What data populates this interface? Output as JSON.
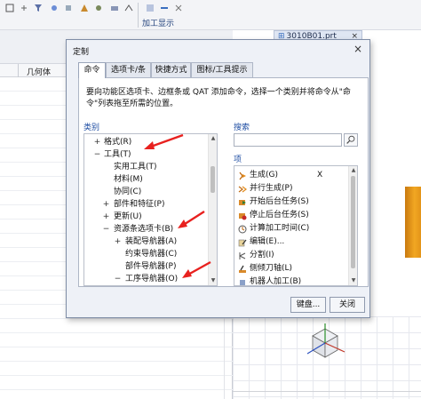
{
  "ribbon": {
    "group_label": "加工显示"
  },
  "left_panel": {
    "column_header": "几何体"
  },
  "document_tab": {
    "title": "3010B01.prt",
    "close_glyph": "×"
  },
  "dialog": {
    "title": "定制",
    "close_glyph": "×",
    "tabs": [
      {
        "label": "命令",
        "active": true
      },
      {
        "label": "选项卡/条",
        "active": false
      },
      {
        "label": "快捷方式",
        "active": false
      },
      {
        "label": "图标/工具提示",
        "active": false
      }
    ],
    "description": "要向功能区选项卡、边框条或 QAT 添加命令，选择一个类别并将命令从\"命令\"列表拖至所需的位置。",
    "categories": {
      "label": "类别",
      "rows": [
        {
          "expander": "+",
          "text": "格式(R)"
        },
        {
          "expander": "−",
          "text": "工具(T)"
        },
        {
          "expander": "",
          "text": "实用工具(T)"
        },
        {
          "expander": "",
          "text": "材料(M)"
        },
        {
          "expander": "",
          "text": "协同(C)"
        },
        {
          "expander": "+",
          "text": "部件和特征(P)"
        },
        {
          "expander": "+",
          "text": "更新(U)"
        },
        {
          "expander": "−",
          "text": "资源条选项卡(B)"
        },
        {
          "expander": "+",
          "text": "装配导航器(A)"
        },
        {
          "expander": "",
          "text": "约束导航器(C)"
        },
        {
          "expander": "",
          "text": "部件导航器(P)"
        },
        {
          "expander": "−",
          "text": "工序导航器(O)"
        }
      ]
    },
    "search": {
      "label": "搜索",
      "value": ""
    },
    "items": {
      "label": "项",
      "rows": [
        {
          "text": "生成(G)",
          "mark": "X",
          "icon": "generate-icon"
        },
        {
          "text": "并行生成(P)",
          "mark": "",
          "icon": "parallel-generate-icon"
        },
        {
          "text": "开始后台任务(S)",
          "mark": "",
          "icon": "start-background-task-icon"
        },
        {
          "text": "停止后台任务(S)",
          "mark": "",
          "icon": "stop-background-task-icon"
        },
        {
          "text": "计算加工时间(C)",
          "mark": "",
          "icon": "machining-time-icon"
        },
        {
          "text": "编辑(E)...",
          "mark": "",
          "icon": "edit-icon"
        },
        {
          "text": "分割(I)",
          "mark": "",
          "icon": "split-icon"
        },
        {
          "text": "侧倾刀轴(L)",
          "mark": "",
          "icon": "tilt-tool-axis-icon"
        },
        {
          "text": "机器人加工(B)",
          "mark": "",
          "icon": "robot-machining-icon"
        }
      ]
    },
    "buttons": {
      "keyboard": "键盘...",
      "close": "关闭"
    }
  },
  "colors": {
    "annotation_arrow": "#e8211f",
    "link_blue": "#1f4ea3",
    "dialog_bg": "#eef1f7",
    "part_orange": "#f2a722"
  }
}
